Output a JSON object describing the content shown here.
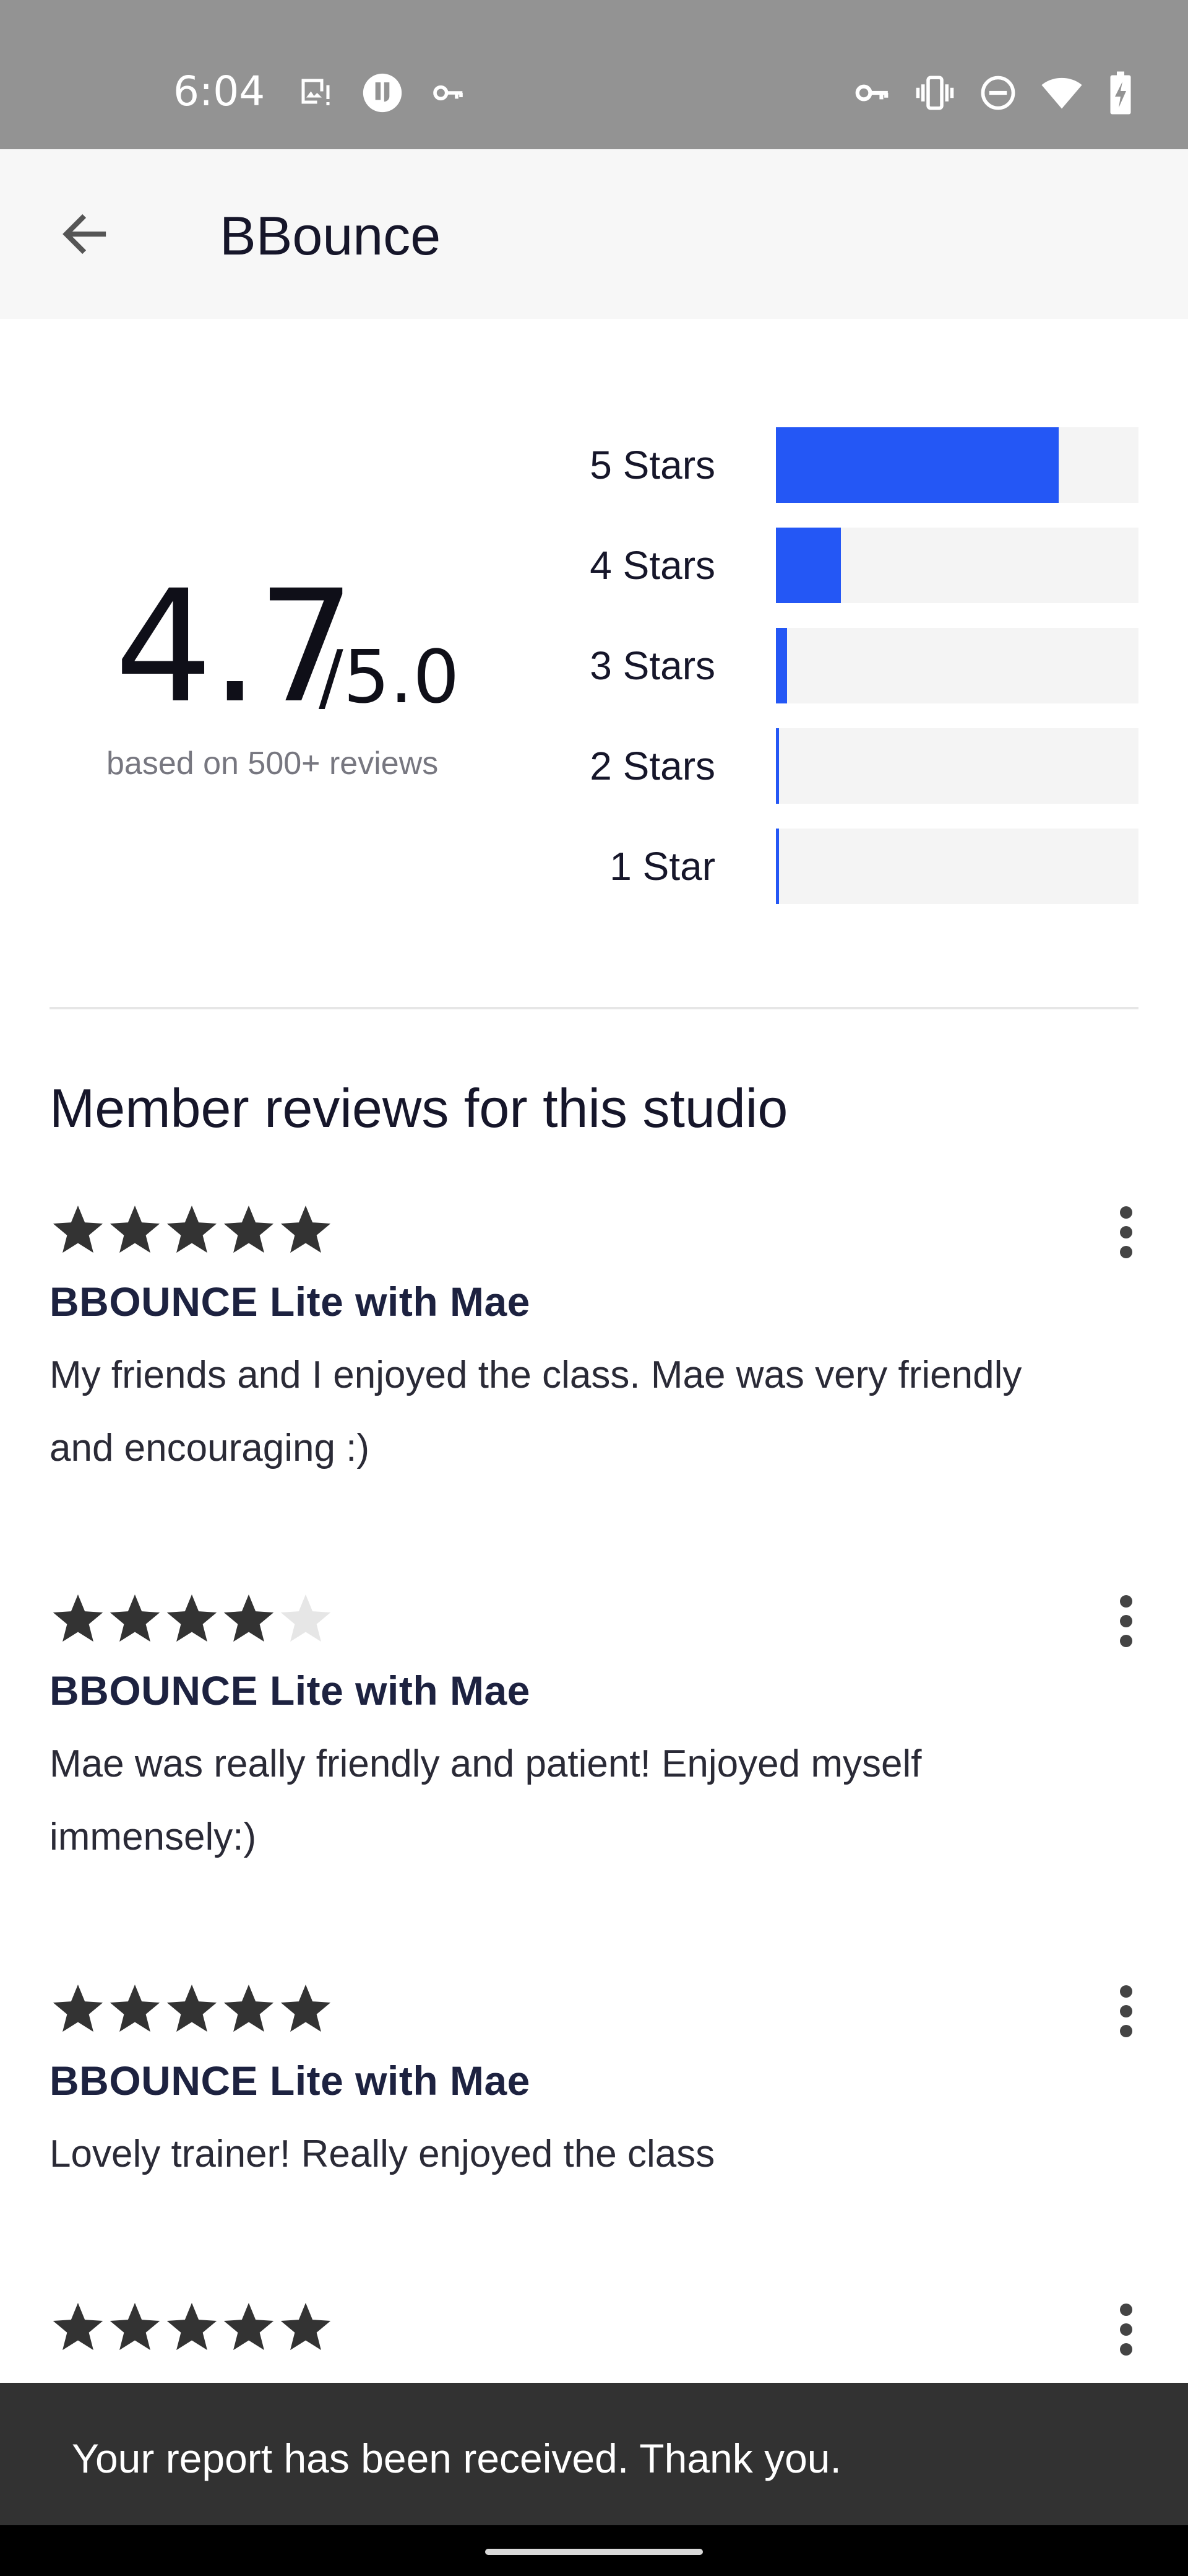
{
  "status_bar": {
    "time": "6:04",
    "left_icons": [
      "image-alert-icon",
      "app-badge-icon",
      "vpn-key-icon"
    ],
    "right_icons": [
      "vpn-key-icon",
      "vibrate-icon",
      "do-not-disturb-icon",
      "wifi-icon",
      "battery-charging-icon"
    ]
  },
  "app_bar": {
    "back_icon": "arrow-back-icon",
    "title": "BBounce"
  },
  "rating": {
    "average": "4.7",
    "out_of": "/5.0",
    "note": "based on 500+ reviews",
    "distribution": [
      {
        "label": "5 Stars",
        "fraction": 0.78
      },
      {
        "label": "4 Stars",
        "fraction": 0.18
      },
      {
        "label": "3 Stars",
        "fraction": 0.03
      },
      {
        "label": "2 Stars",
        "fraction": 0.005
      },
      {
        "label": "1 Star",
        "fraction": 0.005
      }
    ],
    "bar_color": "#2457f5",
    "track_color": "#f4f4f4"
  },
  "reviews_section": {
    "title": "Member reviews for this studio",
    "items": [
      {
        "stars": 5,
        "class_name": "BBOUNCE Lite with Mae",
        "text": "My friends and I enjoyed the class. Mae was very friendly and encouraging :)"
      },
      {
        "stars": 4,
        "class_name": "BBOUNCE Lite with Mae",
        "text": "Mae was really friendly and patient! Enjoyed myself immensely:)"
      },
      {
        "stars": 5,
        "class_name": "BBOUNCE Lite with Mae",
        "text": "Lovely trainer! Really enjoyed the class"
      },
      {
        "stars": 5,
        "class_name": "",
        "text": ""
      }
    ],
    "more_icon": "more-vert-icon",
    "star_filled_color": "#333333",
    "star_empty_color": "#e6e6e6"
  },
  "snackbar": {
    "message": "Your report has been received. Thank you."
  }
}
